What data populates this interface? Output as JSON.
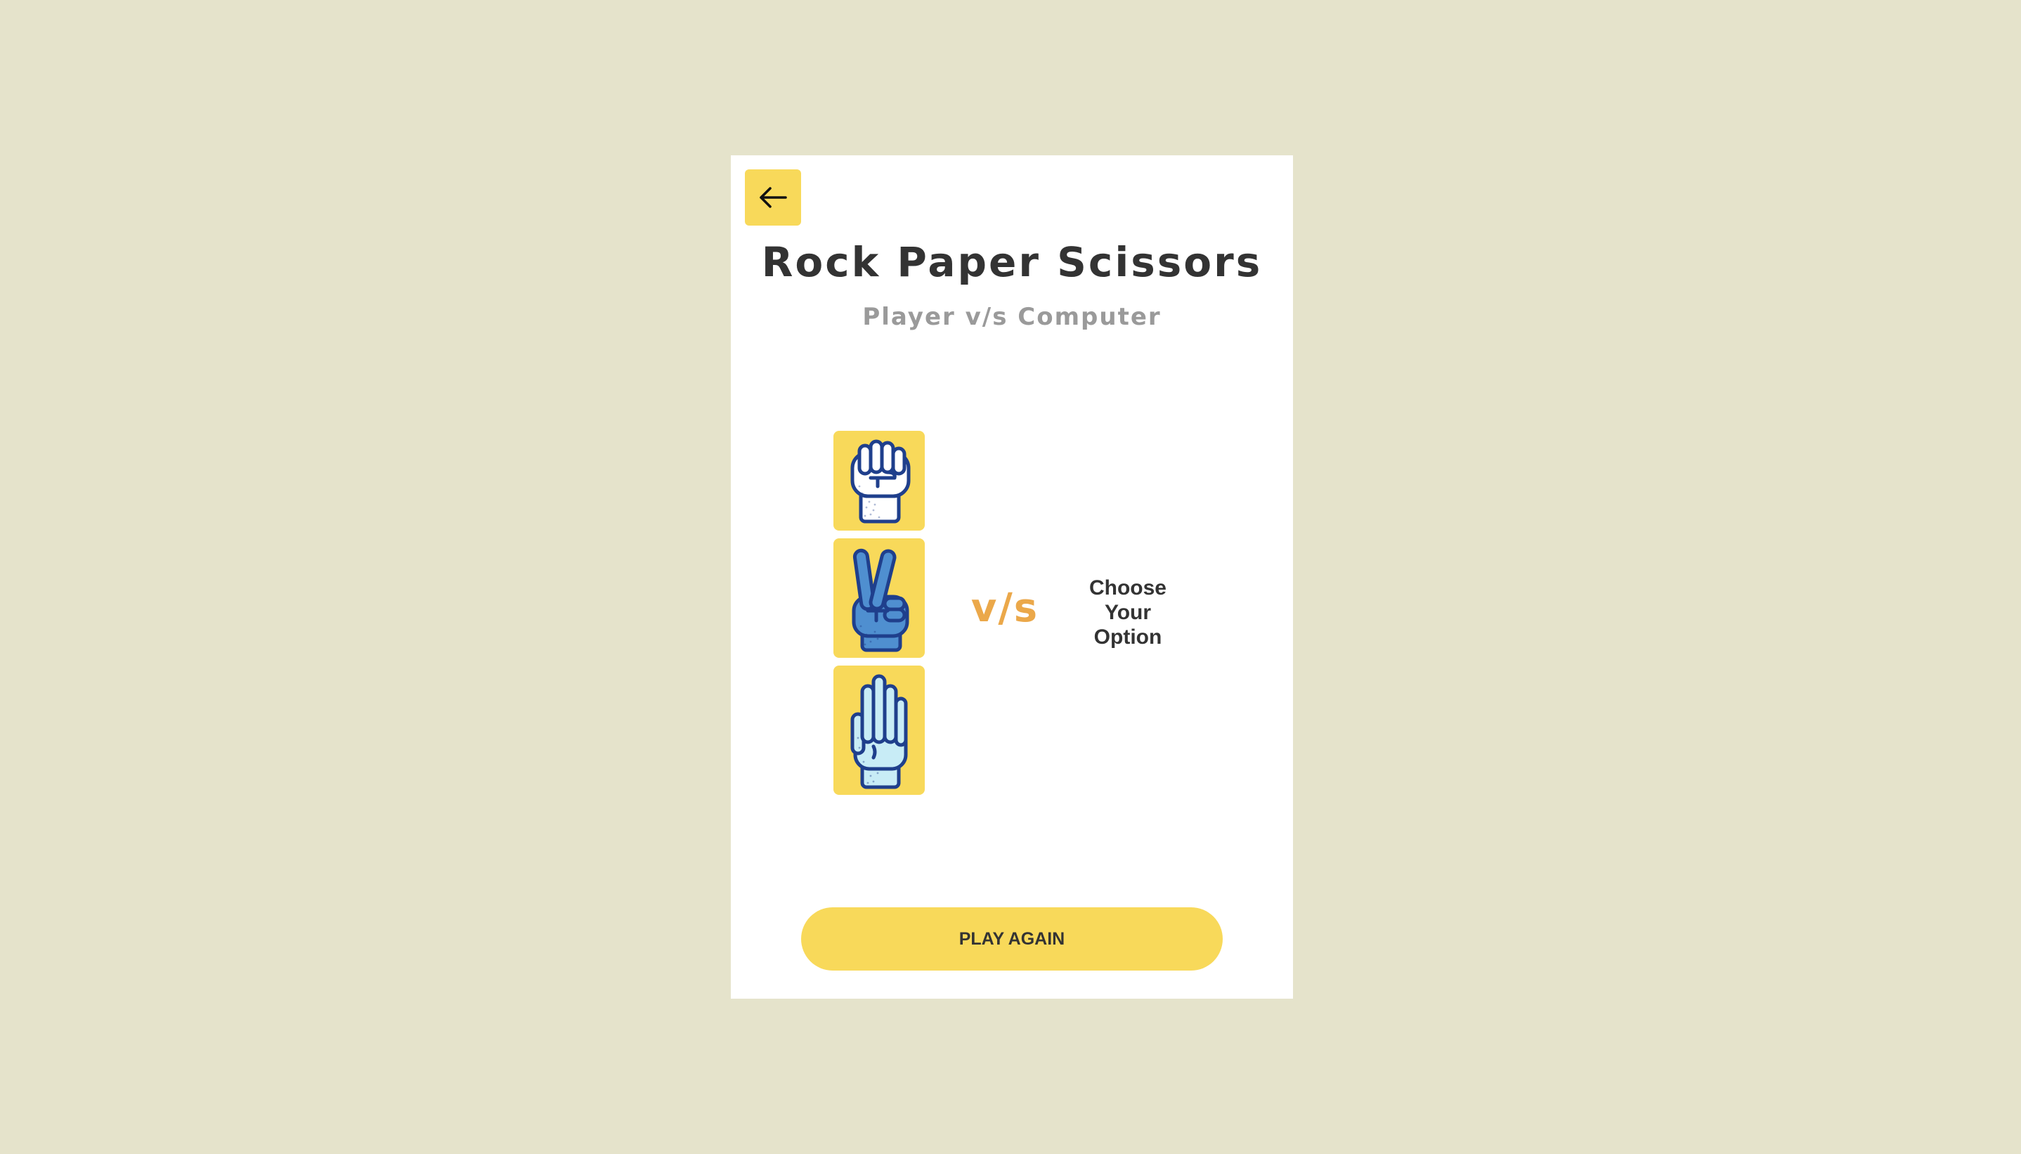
{
  "header": {
    "title": "Rock Paper Scissors",
    "subtitle": "Player v/s Computer"
  },
  "back_button": {
    "icon": "arrow-left-icon"
  },
  "options": [
    {
      "name": "rock",
      "icon": "rock-hand-icon"
    },
    {
      "name": "scissors",
      "icon": "scissors-hand-icon"
    },
    {
      "name": "paper",
      "icon": "paper-hand-icon"
    }
  ],
  "versus": {
    "label": "v/s"
  },
  "computer": {
    "prompt_lines": [
      "Choose",
      "Your",
      "Option"
    ]
  },
  "actions": {
    "play_again_label": "PLAY AGAIN"
  },
  "colors": {
    "background": "#e5e3cb",
    "card": "#ffffff",
    "accent_yellow": "#f8d95a",
    "versus_orange": "#eba84a",
    "title_text": "#333333",
    "subtitle_text": "#9a9a9a",
    "hand_navy": "#1f3f8c",
    "hand_blue": "#4f8fd0",
    "hand_light_blue": "#c8ecf6"
  }
}
